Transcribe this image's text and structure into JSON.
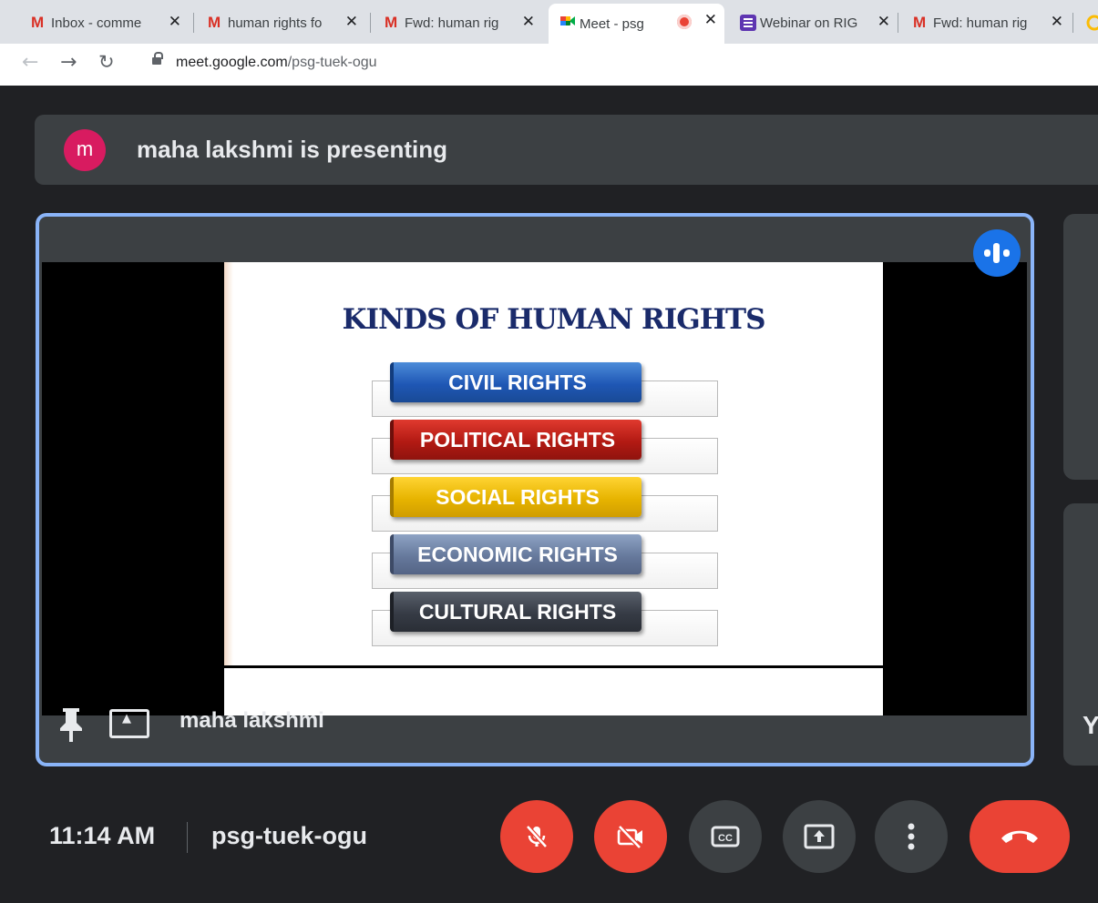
{
  "browser": {
    "tabs": [
      {
        "title": "Inbox - comme",
        "icon": "gmail-icon"
      },
      {
        "title": "human rights fo",
        "icon": "gmail-icon"
      },
      {
        "title": "Fwd: human rig",
        "icon": "gmail-icon"
      },
      {
        "title": "Meet - psg",
        "icon": "meet-icon",
        "active": true,
        "recording": true
      },
      {
        "title": "Webinar on RIG",
        "icon": "forms-icon"
      },
      {
        "title": "Fwd: human rig",
        "icon": "gmail-icon"
      }
    ],
    "url_host": "meet.google.com",
    "url_path": "/psg-tuek-ogu"
  },
  "meet": {
    "presenting_banner": {
      "avatar_letter": "m",
      "text": "maha lakshmi is presenting"
    },
    "main_tile": {
      "participant_name": "maha lakshmi",
      "slide": {
        "title": "KINDS OF HUMAN RIGHTS",
        "items": [
          {
            "label": "CIVIL RIGHTS",
            "color": "#1f57b5"
          },
          {
            "label": "POLITICAL RIGHTS",
            "color": "#b31a13"
          },
          {
            "label": "SOCIAL RIGHTS",
            "color": "#e7b400"
          },
          {
            "label": "ECONOMIC RIGHTS",
            "color": "#66799c"
          },
          {
            "label": "CULTURAL RIGHTS",
            "color": "#363b45"
          }
        ]
      }
    },
    "side_tile_letter": "Y",
    "bottom_bar": {
      "time": "11:14 AM",
      "meeting_code": "psg-tuek-ogu",
      "controls": [
        {
          "name": "microphone-off",
          "icon": "mic-off-icon"
        },
        {
          "name": "camera-off",
          "icon": "video-off-icon"
        },
        {
          "name": "captions",
          "icon": "cc-icon"
        },
        {
          "name": "present-now",
          "icon": "present-icon"
        },
        {
          "name": "more-options",
          "icon": "more-vert-icon"
        },
        {
          "name": "leave-call",
          "icon": "call-end-icon"
        }
      ]
    },
    "colors": {
      "accent": "#8ab4f8",
      "danger": "#ea4335",
      "surface": "#3c4043",
      "background": "#202124"
    }
  }
}
